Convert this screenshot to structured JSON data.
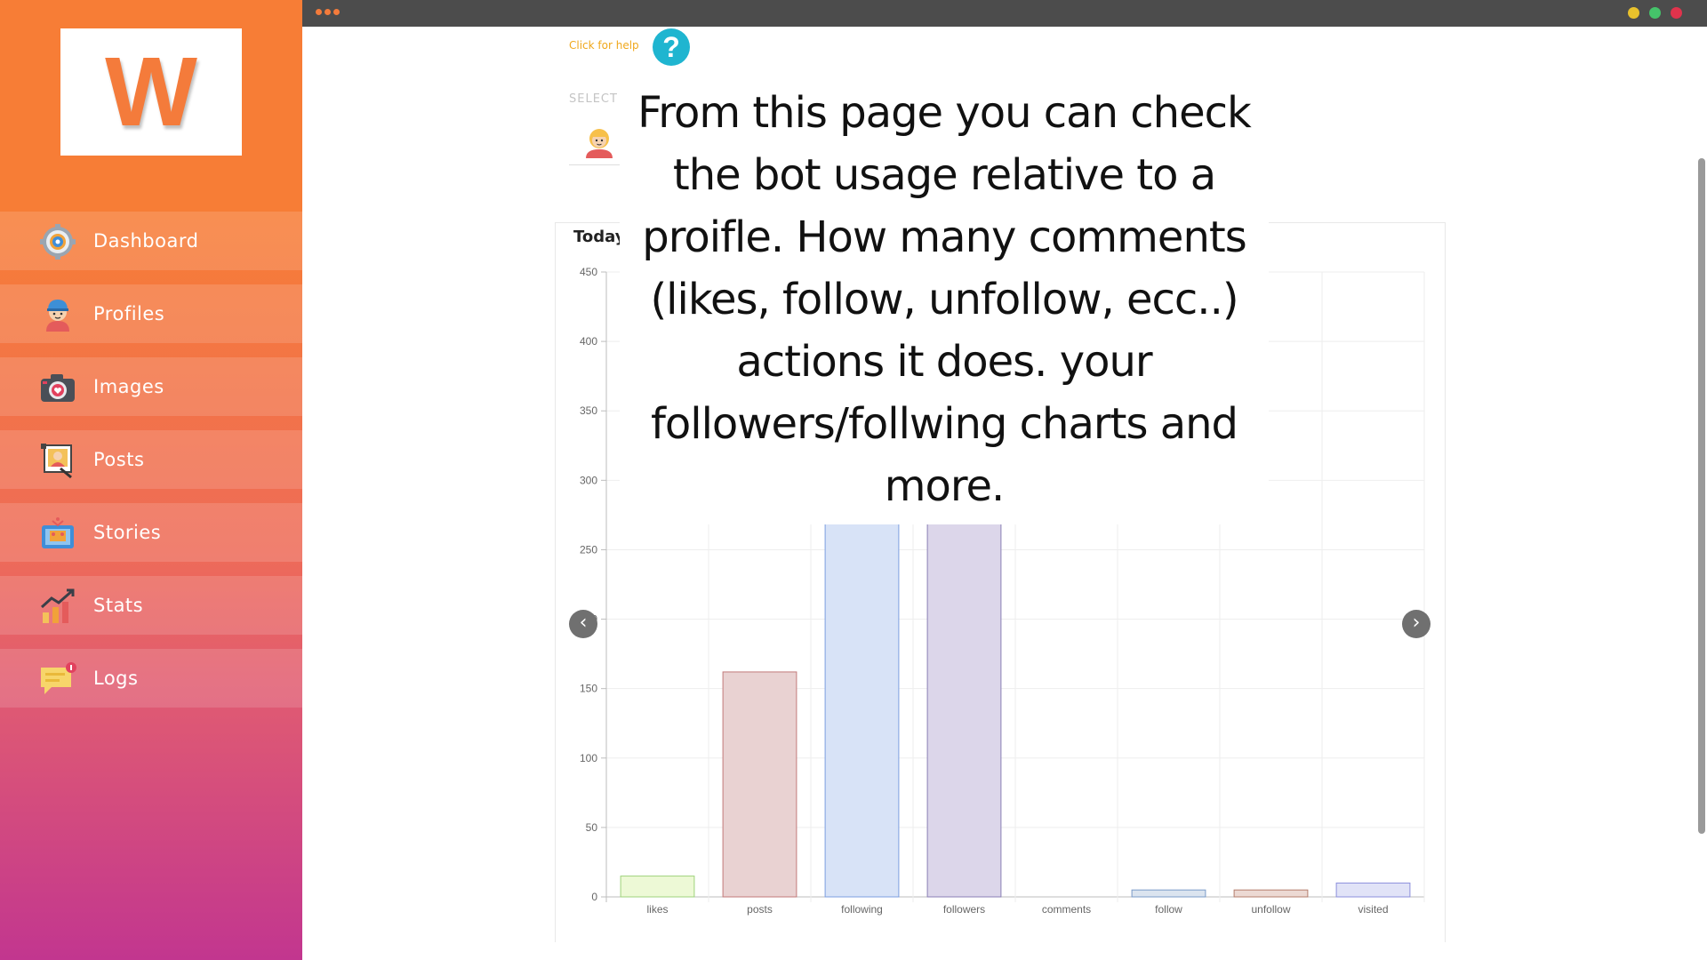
{
  "app": {
    "logo_letter": "W"
  },
  "sidebar": {
    "items": [
      {
        "label": "Dashboard",
        "icon": "dashboard-gear-icon"
      },
      {
        "label": "Profiles",
        "icon": "profile-avatar-icon"
      },
      {
        "label": "Images",
        "icon": "camera-icon"
      },
      {
        "label": "Posts",
        "icon": "post-picture-icon"
      },
      {
        "label": "Stories",
        "icon": "stories-icon"
      },
      {
        "label": "Stats",
        "icon": "stats-chart-icon"
      },
      {
        "label": "Logs",
        "icon": "chat-log-icon"
      }
    ]
  },
  "topbar": {
    "window_dots": [
      "#e8c12c",
      "#45c36a",
      "#e0334c"
    ]
  },
  "help": {
    "link_text": "Click for help",
    "button_text": "?"
  },
  "profile_select": {
    "label": "SELECT"
  },
  "card": {
    "title": "Today"
  },
  "overlay": {
    "text": "From this page you can check the bot usage relative to a proifle. How many comments (likes, follow, unfollow, ecc..) actions it does. your followers/follwing charts and more."
  },
  "chart_data": {
    "type": "bar",
    "title": "Today",
    "categories": [
      "likes",
      "posts",
      "following",
      "followers",
      "comments",
      "follow",
      "unfollow",
      "visited"
    ],
    "values": [
      15,
      162,
      355,
      350,
      0,
      5,
      5,
      10
    ],
    "ylim": [
      0,
      450
    ],
    "yticks": [
      0,
      50,
      100,
      150,
      200,
      250,
      300,
      350,
      400,
      450
    ],
    "grid": true,
    "colors": {
      "fill": [
        "#edf9d6",
        "#e9d2d2",
        "#d8e3f7",
        "#dcd6ea",
        "#eeeeee",
        "#dbe4ef",
        "#ecd9d3",
        "#e1e3f7"
      ],
      "stroke": [
        "#9fd37c",
        "#c27a7a",
        "#7d9fe0",
        "#8a7fb5",
        "#bbbbbb",
        "#7b9bc8",
        "#b47e6d",
        "#8c8fdc"
      ]
    }
  }
}
